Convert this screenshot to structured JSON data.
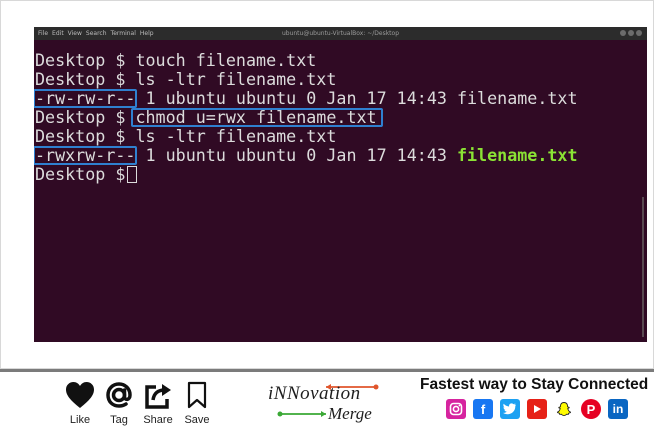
{
  "window": {
    "title": "ubuntu@ubuntu-VirtualBox: ~/Desktop",
    "menu": [
      "File",
      "Edit",
      "View",
      "Search",
      "Terminal",
      "Help"
    ]
  },
  "terminal": {
    "lines": [
      {
        "prompt": "Desktop $",
        "command": "touch filename.txt"
      },
      {
        "prompt": "Desktop $",
        "command": "ls -ltr filename.txt"
      },
      {
        "perms": "-rw-rw-r--",
        "rest": "1 ubuntu ubuntu 0 Jan 17 14:43 filename.txt"
      },
      {
        "prompt": "Desktop $",
        "command": "chmod u=rwx filename.txt"
      },
      {
        "prompt": "Desktop $",
        "command": "ls -ltr filename.txt"
      },
      {
        "perms": "-rwxrw-r--",
        "rest": "1 ubuntu ubuntu 0 Jan 17 14:43",
        "file": "filename.txt"
      },
      {
        "prompt": "Desktop $"
      }
    ],
    "colors": {
      "background": "#300a24",
      "text": "#dcdcdc",
      "executable": "#8ae234",
      "highlight_box": "#2f80d0"
    }
  },
  "footer": {
    "social_actions": [
      {
        "icon": "heart-icon",
        "label": "Like"
      },
      {
        "icon": "at-icon",
        "label": "Tag"
      },
      {
        "icon": "share-icon",
        "label": "Share"
      },
      {
        "icon": "bookmark-icon",
        "label": "Save"
      }
    ],
    "logo": {
      "line1": "iNNovation",
      "line2": "Merge"
    },
    "tagline": "Fastest way to Stay Connected",
    "brands": [
      {
        "icon": "instagram-icon",
        "color": "#d6249f"
      },
      {
        "icon": "facebook-icon",
        "color": "#1877f2"
      },
      {
        "icon": "twitter-icon",
        "color": "#1da1f2"
      },
      {
        "icon": "youtube-icon",
        "color": "#e62117"
      },
      {
        "icon": "snapchat-icon",
        "color": "#fffc00"
      },
      {
        "icon": "pinterest-icon",
        "color": "#e60023"
      },
      {
        "icon": "linkedin-icon",
        "color": "#0a66c2"
      }
    ]
  }
}
